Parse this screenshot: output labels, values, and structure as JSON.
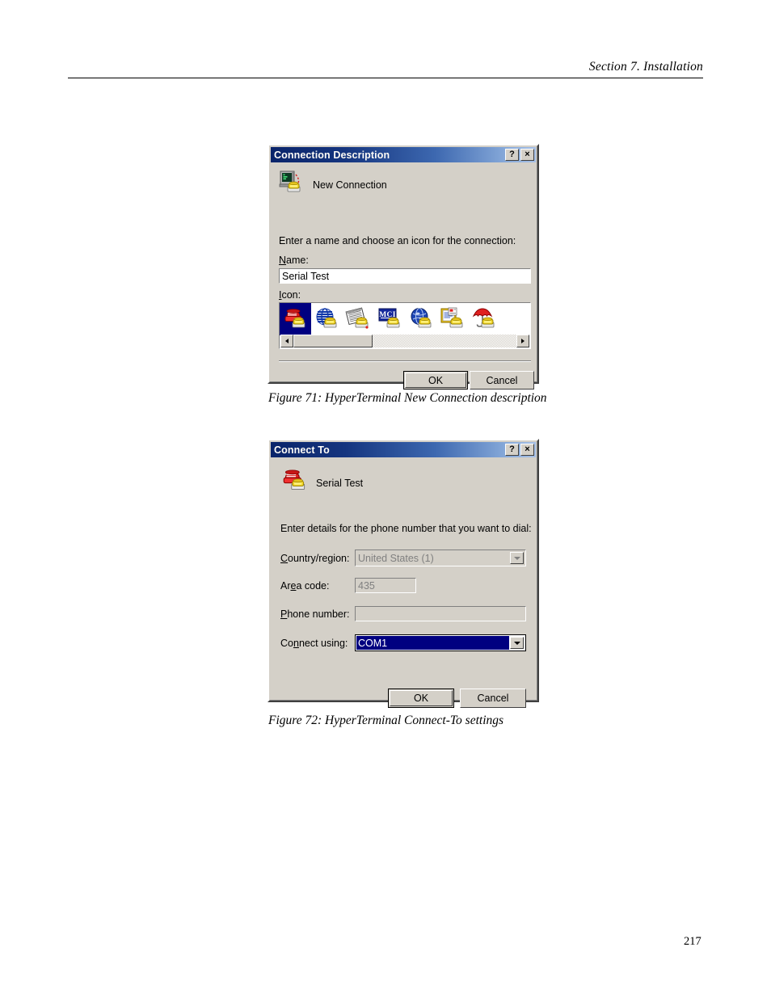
{
  "page": {
    "header": "Section 7.  Installation",
    "number": "217"
  },
  "figures": [
    {
      "caption": "Figure 71: HyperTerminal New Connection description"
    },
    {
      "caption": "Figure 72: HyperTerminal Connect-To settings"
    }
  ],
  "colors": {
    "dialog_face": "#d4d0c8",
    "titlebar_start": "#0a246a",
    "titlebar_end": "#a6c0e6",
    "selection": "#000080",
    "disabled_text": "#808080"
  },
  "dialog_connection_description": {
    "title": "Connection Description",
    "help_button": "?",
    "close_button": "×",
    "connection_icon": "computer-modem-icon",
    "connection_name": "New Connection",
    "prompt": "Enter a name and choose an icon for the connection:",
    "name_label": "Name:",
    "name_value": "Serial Test",
    "name_placeholder": "",
    "icon_label": "Icon:",
    "icons": [
      {
        "name": "red-telephone-icon",
        "selected": true
      },
      {
        "name": "blue-globe-phone-icon",
        "selected": false
      },
      {
        "name": "newspaper-phone-icon",
        "selected": false
      },
      {
        "name": "mci-phone-icon",
        "selected": false
      },
      {
        "name": "blue-ge-globe-phone-icon",
        "selected": false
      },
      {
        "name": "document-clipboard-phone-icon",
        "selected": false
      },
      {
        "name": "red-umbrella-phone-icon",
        "selected": false
      }
    ],
    "scroll_left_arrow": "◀",
    "scroll_right_arrow": "▶",
    "ok_label": "OK",
    "cancel_label": "Cancel"
  },
  "dialog_connect_to": {
    "title": "Connect To",
    "help_button": "?",
    "close_button": "×",
    "connection_icon": "red-telephone-icon",
    "connection_name": "Serial Test",
    "prompt": "Enter details for the phone number that you want to dial:",
    "fields": [
      {
        "label": "Country/region:",
        "label_pre": "C",
        "label_accel": "o",
        "label_post": "untry/region:",
        "value": "United States (1)",
        "type": "combobox",
        "disabled": true
      },
      {
        "label": "Area code:",
        "label_pre": "Ar",
        "label_accel": "e",
        "label_post": "a code:",
        "value": "435",
        "type": "text",
        "disabled": true
      },
      {
        "label": "Phone number:",
        "label_pre": "",
        "label_accel": "P",
        "label_post": "hone number:",
        "value": "",
        "type": "text",
        "disabled": true
      },
      {
        "label": "Connect using:",
        "label_pre": "Con",
        "label_accel": "n",
        "label_post": "ect using:",
        "value": "COM1",
        "type": "combobox",
        "disabled": false,
        "focused": true
      }
    ],
    "ok_label": "OK",
    "cancel_label": "Cancel"
  }
}
